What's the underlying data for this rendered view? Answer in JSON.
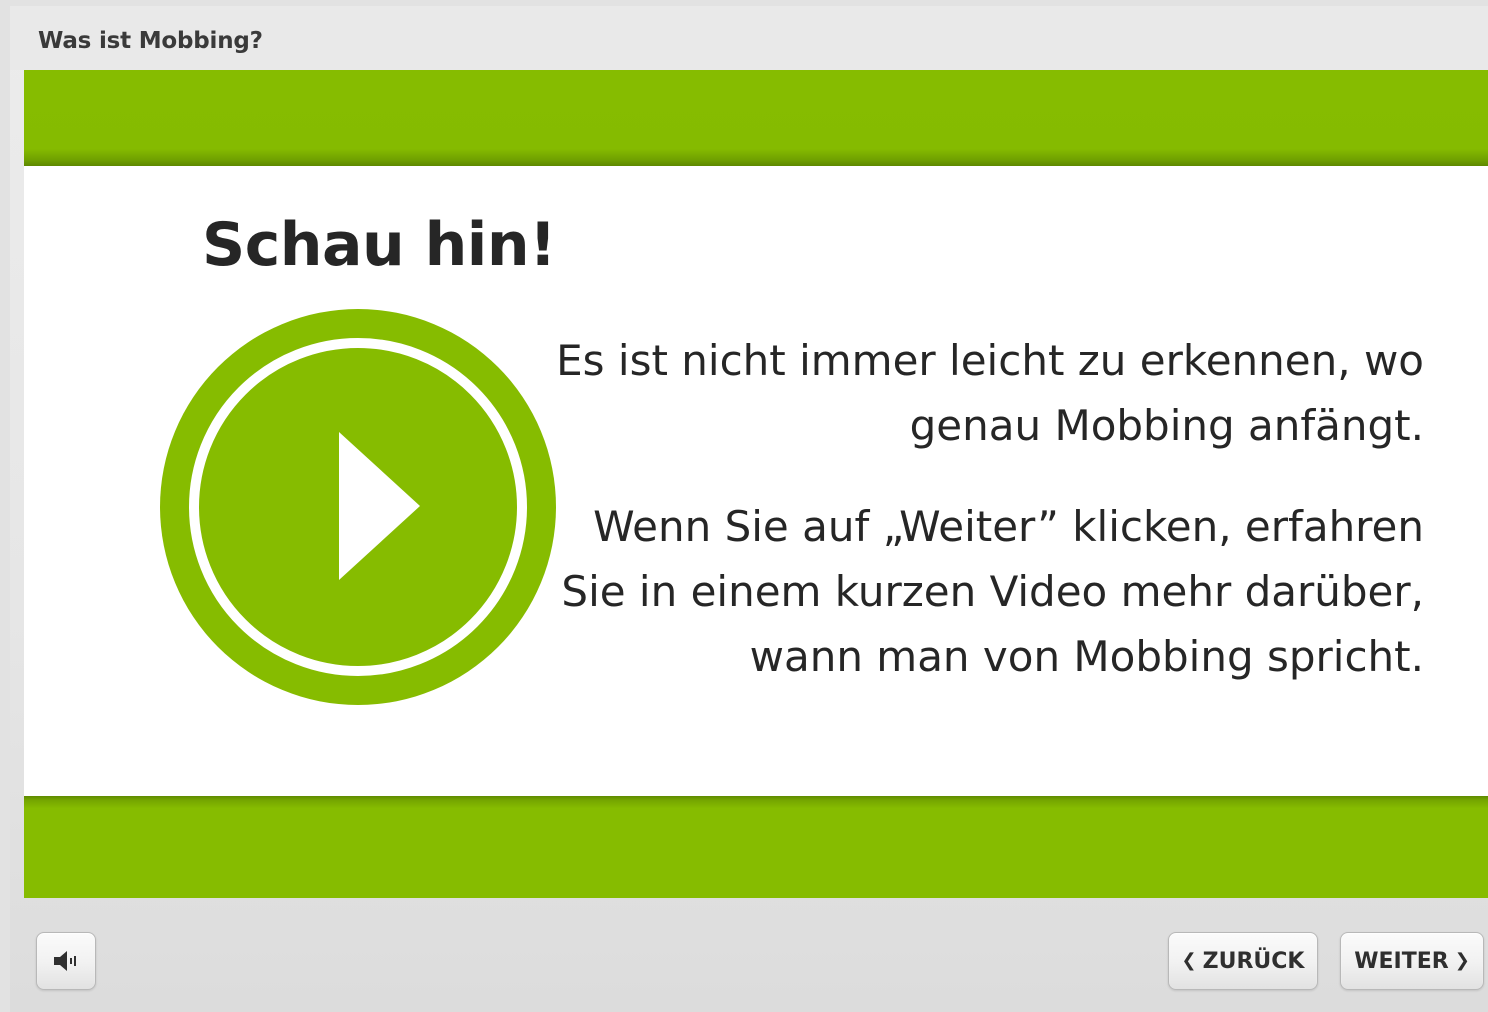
{
  "window": {
    "title": "Was ist Mobbing?"
  },
  "slide": {
    "headline": "Schau hin!",
    "paragraphs": [
      "Es ist nicht immer leicht zu erkennen, wo genau Mobbing anfängt.",
      "Wenn Sie auf „Weiter” klicken, erfahren Sie in einem kurzen Video mehr darüber, wann man von Mobbing spricht."
    ],
    "play_icon": "play-icon"
  },
  "controls": {
    "mute_icon": "speaker-icon",
    "back_label": "ZURÜCK",
    "back_icon": "chevron-left-icon",
    "next_label": "WEITER",
    "next_icon": "chevron-right-icon"
  },
  "colors": {
    "accent_green": "#86bc00",
    "text_dark": "#262626",
    "chrome_gray": "#e2e2e2"
  }
}
